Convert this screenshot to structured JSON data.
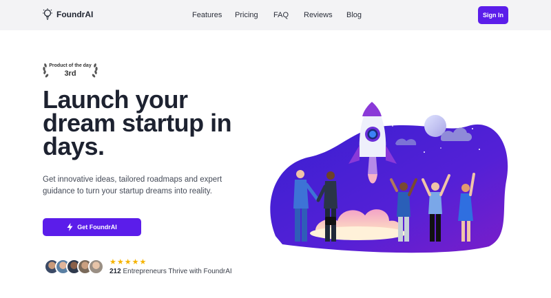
{
  "nav": {
    "brand": "FoundrAI",
    "links": [
      "Features",
      "Pricing",
      "FAQ",
      "Reviews",
      "Blog"
    ],
    "signin": "Sign In"
  },
  "award": {
    "label": "Product of the day",
    "rank": "3rd"
  },
  "hero": {
    "headline_lines": [
      "Launch your",
      "dream startup in",
      "days."
    ],
    "subtitle": "Get innovative ideas, tailored roadmaps and expert guidance to turn your startup dreams into reality.",
    "cta": "Get FoundrAI"
  },
  "social_proof": {
    "rating_stars": 5,
    "stars": "★★★★★",
    "count": "212",
    "text": "Entrepreneurs Thrive with FoundrAI"
  },
  "colors": {
    "accent": "#5b1dea",
    "star": "#f5b301",
    "nav_bg": "#f3f3f5"
  },
  "icons": {
    "brand": "lightbulb-icon",
    "cta": "lightning-bolt-icon",
    "award": "laurel-wreath-icon"
  }
}
